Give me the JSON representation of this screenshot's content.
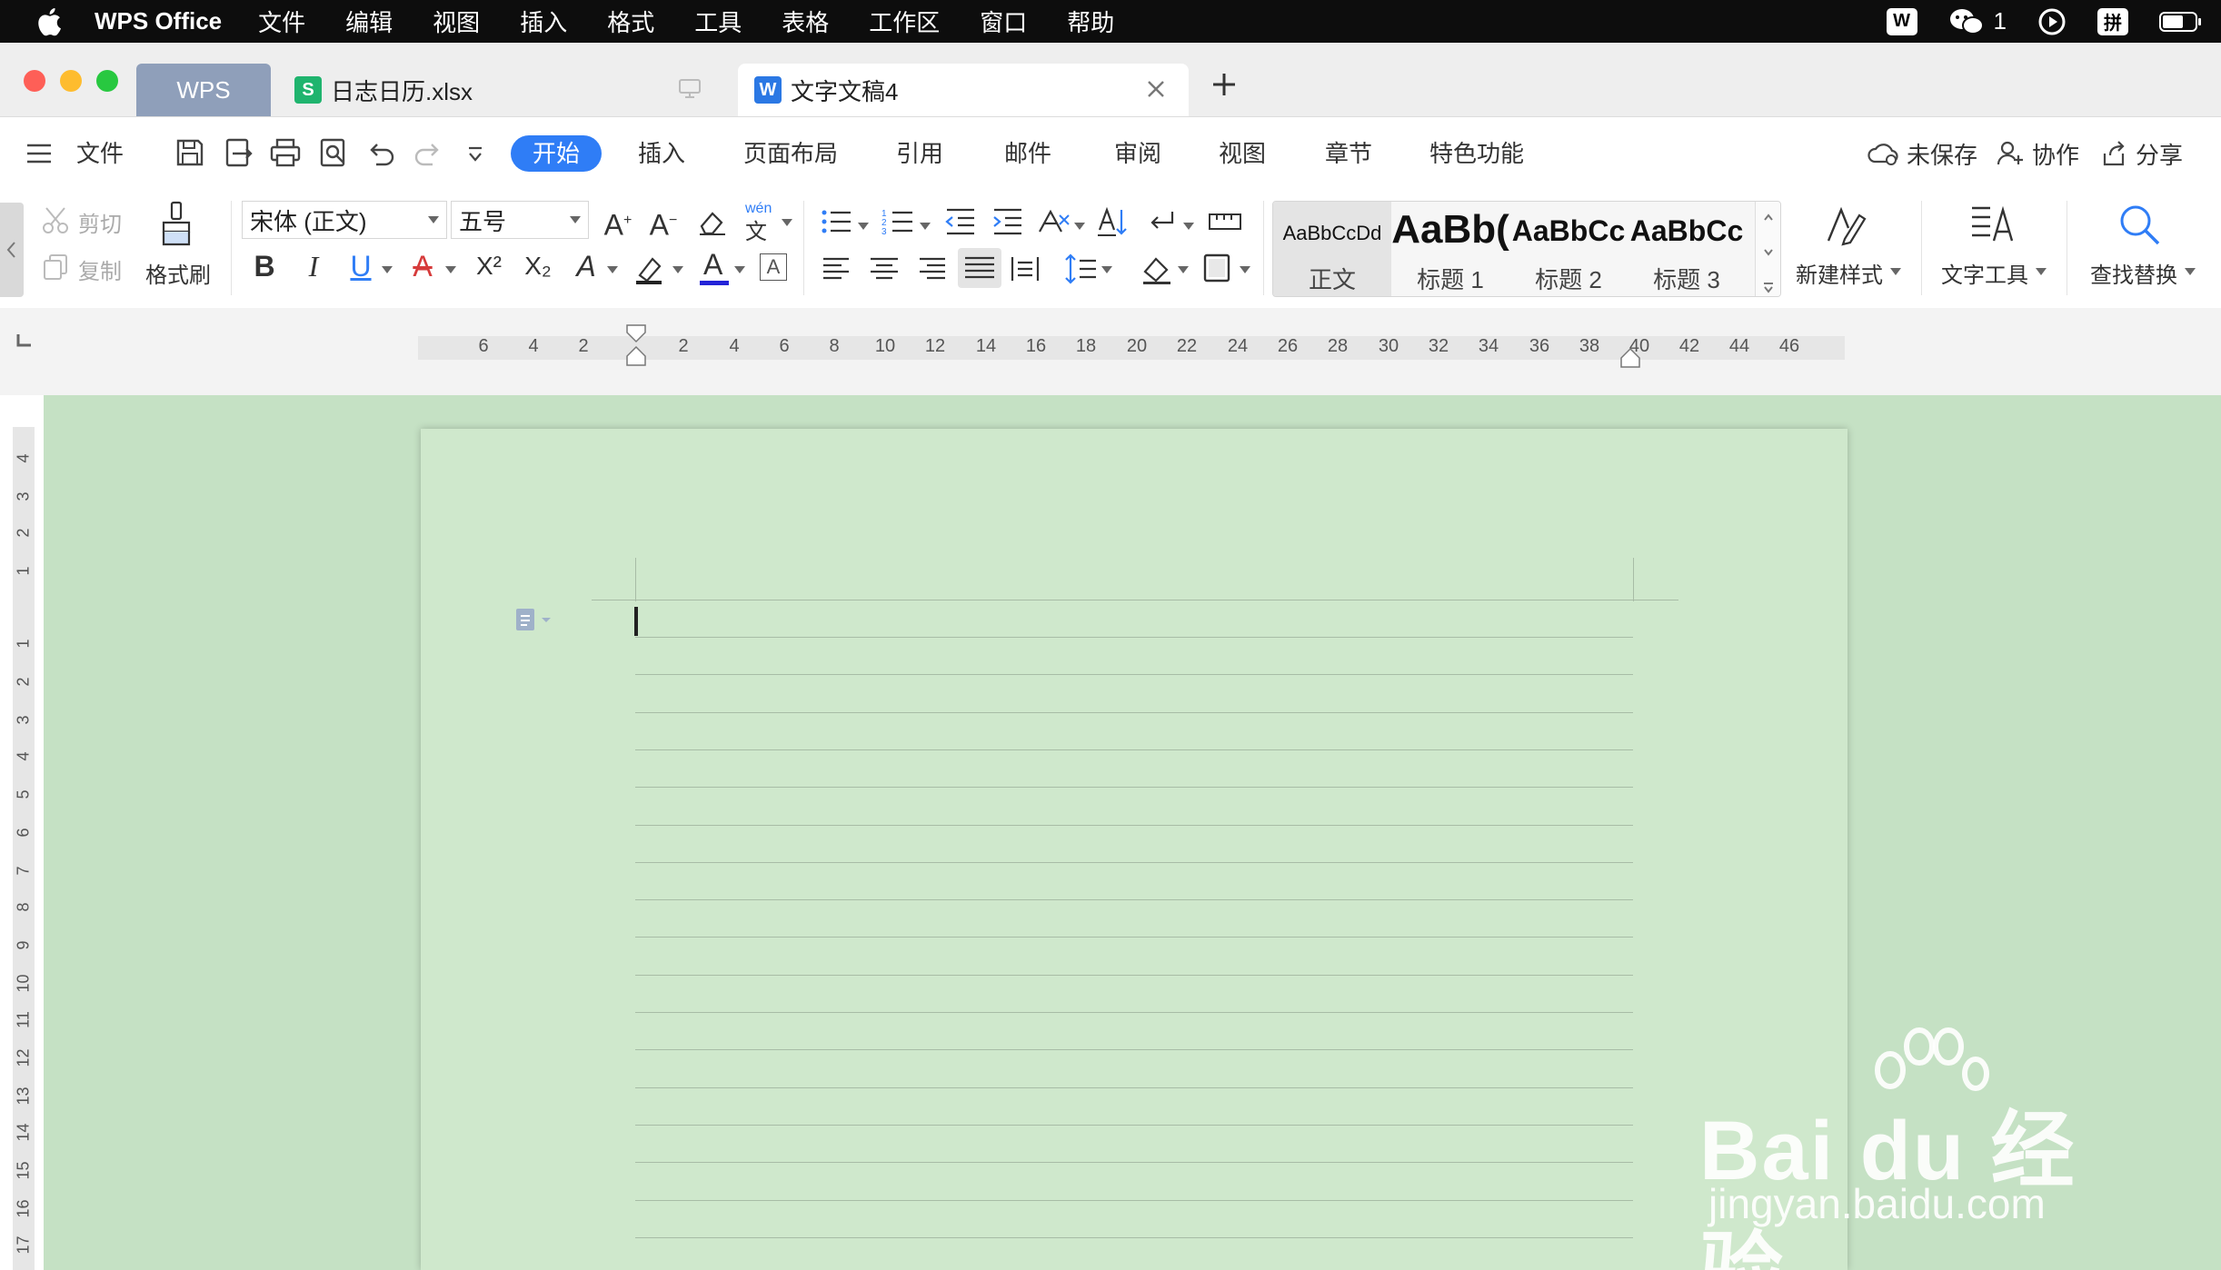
{
  "menubar": {
    "app_name": "WPS Office",
    "items": [
      "文件",
      "编辑",
      "视图",
      "插入",
      "格式",
      "工具",
      "表格",
      "工作区",
      "窗口",
      "帮助"
    ],
    "wechat_count": "1",
    "input_method": "拼"
  },
  "tabs": {
    "home": "WPS",
    "sheet": "日志日历.xlsx",
    "sheet_icon_letter": "S",
    "doc": "文字文稿4",
    "doc_icon_letter": "W"
  },
  "ribbon_tabs": {
    "file": "文件",
    "items": [
      "开始",
      "插入",
      "页面布局",
      "引用",
      "邮件",
      "审阅",
      "视图",
      "章节",
      "特色功能"
    ],
    "unsaved": "未保存",
    "collaborate": "协作",
    "share": "分享"
  },
  "ribbon": {
    "cut": "剪切",
    "copy": "复制",
    "format_painter": "格式刷",
    "font_name": "宋体 (正文)",
    "font_size": "五号",
    "bold": "B",
    "italic": "I",
    "underline": "U",
    "superscript": "X²",
    "subscript": "X₂",
    "pinyin": "wén",
    "styles": [
      {
        "sample": "AaBbCcDd",
        "name": "正文"
      },
      {
        "sample": "AaBb(",
        "name": "标题 1"
      },
      {
        "sample": "AaBbCc",
        "name": "标题 2"
      },
      {
        "sample": "AaBbCc",
        "name": "标题 3"
      }
    ],
    "new_style": "新建样式",
    "text_tools": "文字工具",
    "find_replace": "查找替换"
  },
  "ruler": {
    "h_ticks": [
      "6",
      "4",
      "2",
      "2",
      "4",
      "6",
      "8",
      "10",
      "12",
      "14",
      "16",
      "18",
      "20",
      "22",
      "24",
      "26",
      "28",
      "30",
      "32",
      "34",
      "36",
      "38",
      "40",
      "42",
      "44",
      "46"
    ],
    "v_ticks": [
      "4",
      "3",
      "2",
      "1",
      "1",
      "2",
      "3",
      "4",
      "5",
      "6",
      "7",
      "8",
      "9",
      "10",
      "11",
      "12",
      "13",
      "14",
      "15",
      "16",
      "17"
    ]
  },
  "watermark": {
    "main": "Bai du 经验",
    "sub": "jingyan.baidu.com"
  },
  "colors": {
    "accent": "#2f7df6",
    "page_background": "#cfe8cc",
    "canvas_background": "#c5e1c4",
    "sheet_icon": "#1fb46e",
    "doc_icon": "#2b78e4"
  }
}
